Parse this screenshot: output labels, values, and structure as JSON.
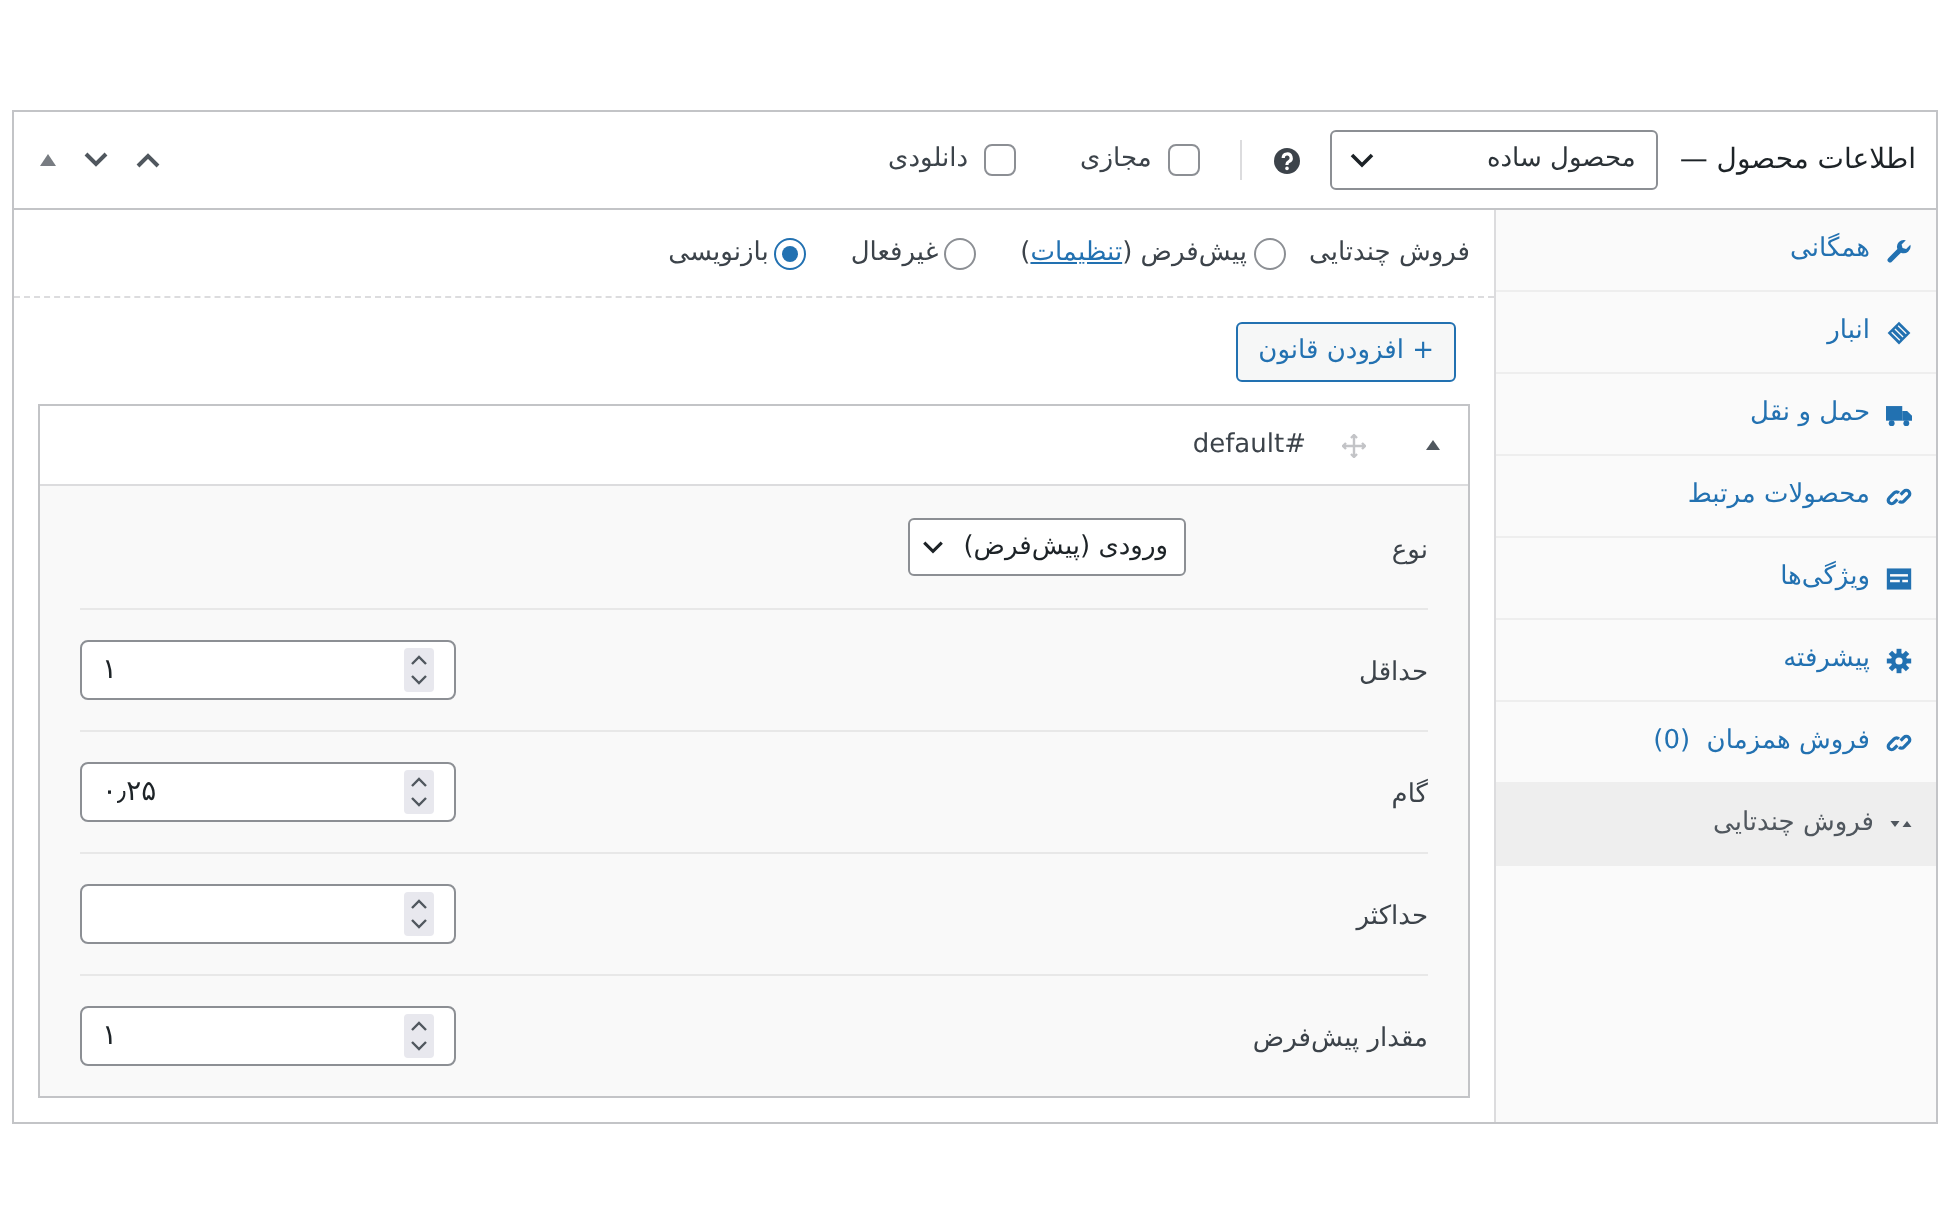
{
  "header": {
    "title": "اطلاعات محصول —",
    "product_type": {
      "value": "محصول ساده"
    },
    "options": [
      {
        "label": "مجازی",
        "checked": false
      },
      {
        "label": "دانلودی",
        "checked": false
      }
    ]
  },
  "tabs": [
    {
      "label": "همگانی",
      "selected": false
    },
    {
      "label": "انبار",
      "selected": false
    },
    {
      "label": "حمل و نقل",
      "selected": false
    },
    {
      "label": "محصولات مرتبط",
      "selected": false
    },
    {
      "label": "ویژگی‌ها",
      "selected": false
    },
    {
      "label": "پیشرفته",
      "selected": false
    },
    {
      "label": "فروش همزمان  (0)",
      "selected": false
    },
    {
      "label": "فروش چندتایی",
      "selected": true
    }
  ],
  "bulk_sale": {
    "label": "فروش چندتایی",
    "modes": [
      {
        "label": "پیش‌فرض (",
        "link": "تنظیمات",
        "label_end": ")",
        "selected": false
      },
      {
        "label": "غیرفعال",
        "selected": false
      },
      {
        "label": "بازنویسی",
        "selected": true
      }
    ],
    "add_button": "+ افزودن قانون",
    "rule": {
      "title": "default#",
      "expanded": true,
      "fields": [
        {
          "label": "نوع",
          "kind": "select",
          "value": "ورودی (پیش‌فرض)"
        },
        {
          "label": "حداقل",
          "kind": "number",
          "value": "۱"
        },
        {
          "label": "گام",
          "kind": "number",
          "value": "۰٫۲۵"
        },
        {
          "label": "حداکثر",
          "kind": "number"
        },
        {
          "label": "مقدار پیش‌فرض",
          "kind": "number",
          "value": "۱"
        }
      ]
    }
  }
}
